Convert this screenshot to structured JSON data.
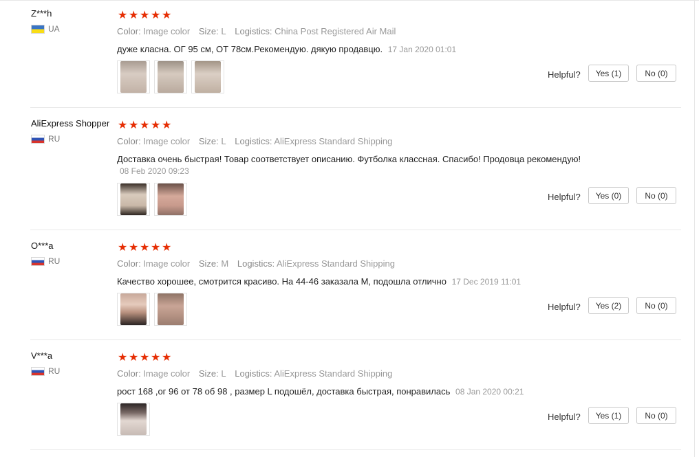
{
  "labels": {
    "color": "Color:",
    "size": "Size:",
    "logistics": "Logistics:",
    "helpful": "Helpful?"
  },
  "colors": {
    "star": "#e62e04",
    "meta": "#999999"
  },
  "reviews": [
    {
      "user": "Z***h",
      "country": "UA",
      "flag": "ua-flag-icon",
      "rating": 5,
      "color": "Image color",
      "size": "L",
      "logistics": "China Post Registered Air Mail",
      "text": "дуже класна. ОГ 95 см, ОТ 78см.Рекомендую. дякую продавцю.",
      "date": "17 Jan 2020 01:01",
      "photos": 3,
      "yes": "Yes (1)",
      "no": "No (0)"
    },
    {
      "user": "AliExpress Shopper",
      "country": "RU",
      "flag": "ru-flag-icon",
      "rating": 5,
      "color": "Image color",
      "size": "L",
      "logistics": "AliExpress Standard Shipping",
      "text": "Доставка очень быстрая! Товар соответствует описанию. Футболка классная. Спасибо! Продовца рекомендую!",
      "date": "08 Feb 2020 09:23",
      "photos": 2,
      "yes": "Yes (0)",
      "no": "No (0)"
    },
    {
      "user": "O***a",
      "country": "RU",
      "flag": "ru-flag-icon",
      "rating": 5,
      "color": "Image color",
      "size": "M",
      "logistics": "AliExpress Standard Shipping",
      "text": "Качество хорошее, смотрится красиво. На 44-46 заказала М, подошла отлично",
      "date": "17 Dec 2019 11:01",
      "photos": 2,
      "yes": "Yes (2)",
      "no": "No (0)"
    },
    {
      "user": "V***a",
      "country": "RU",
      "flag": "ru-flag-icon",
      "rating": 5,
      "color": "Image color",
      "size": "L",
      "logistics": "AliExpress Standard Shipping",
      "text": "рост 168 ,ог 96 от 78 об 98 , размер L подошёл, доставка быстрая, понравилась",
      "date": "08 Jan 2020 00:21",
      "photos": 1,
      "yes": "Yes (1)",
      "no": "No (0)"
    }
  ]
}
